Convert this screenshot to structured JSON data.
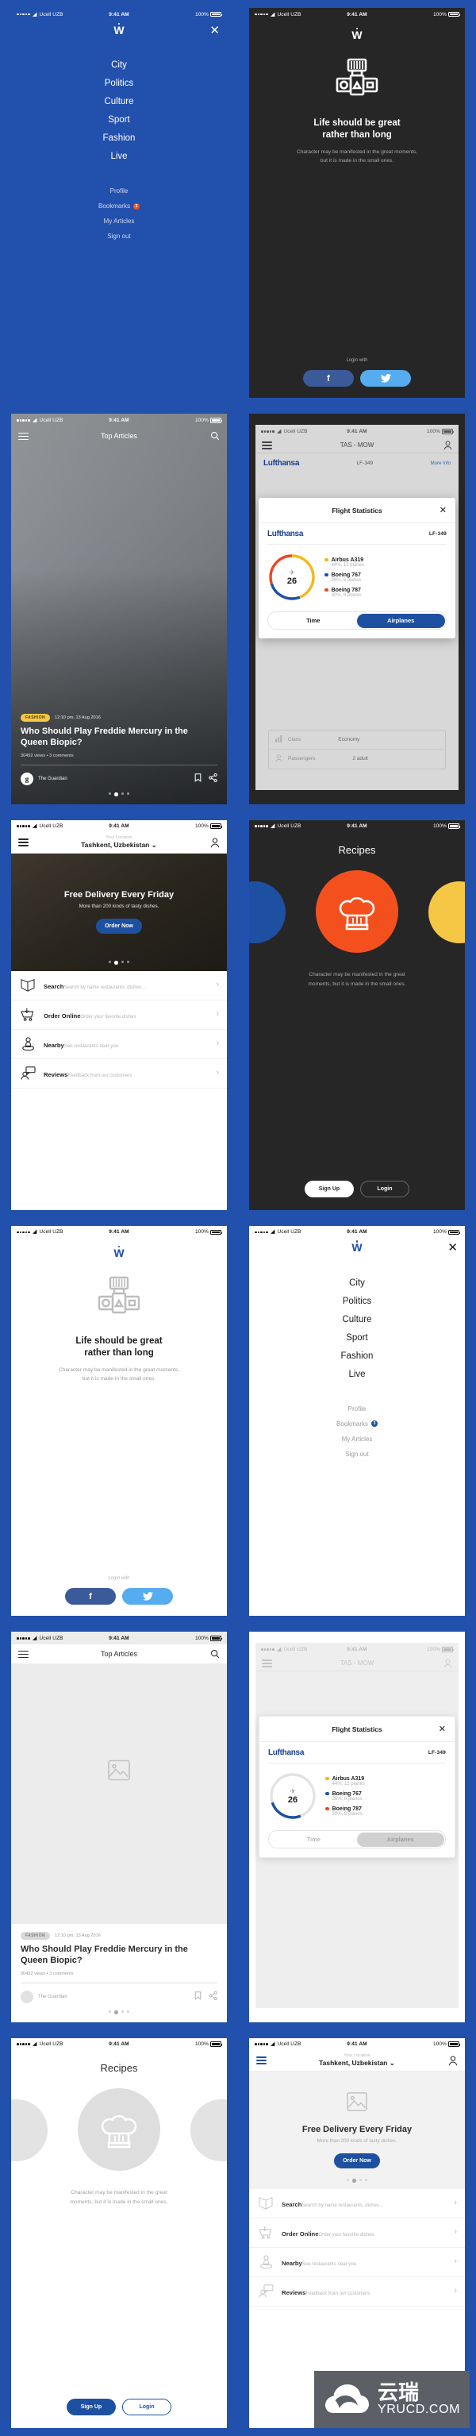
{
  "status_bar": {
    "carrier": "Ucell UZB",
    "time": "9:41 AM",
    "battery": "100%"
  },
  "colors": {
    "brand_blue": "#2250ad",
    "accent_blue": "#1e50a2",
    "dark_bg": "#262626",
    "orange": "#f4511e",
    "yellow": "#f6c744",
    "facebook": "#3b5a9a",
    "twitter": "#55acee",
    "skeleton_grey": "#d8d8d8"
  },
  "menu": {
    "logo": "W",
    "close_label": "✕",
    "primary": [
      "City",
      "Politics",
      "Culture",
      "Sport",
      "Fashion",
      "Live"
    ],
    "secondary": [
      {
        "label": "Profile",
        "badge": ""
      },
      {
        "label": "Bookmarks",
        "badge": "3"
      },
      {
        "label": "My Articles",
        "badge": ""
      },
      {
        "label": "Sign out",
        "badge": ""
      }
    ]
  },
  "onboarding": {
    "logo": "W",
    "headline_line1": "Life should be great",
    "headline_line2": "rather than long",
    "body": "Character may be manifested in the great moments, but it is made in the small ones.",
    "login_with": "Login with",
    "facebook_label": "f",
    "twitter_label": "twitter-bird"
  },
  "article": {
    "nav_title": "Top Articles",
    "tag": "FASHION",
    "timestamp": "12:10 pm, 13 Aug 2016",
    "title": "Who Should Play Freddie Mercury in the Queen Biopic?",
    "meta": "30492 views  •  3 comments",
    "source": "The Guardian",
    "source_initial": "g",
    "pager_total": 4,
    "pager_active": 2
  },
  "flight": {
    "bg_nav_title": "TAS - MOW",
    "bg_airline": "Lufthansa",
    "bg_flight_no": "LF-349",
    "bg_more_info": "More Info",
    "bg_rows": [
      {
        "label": "Class",
        "value": "Economy"
      },
      {
        "label": "Passengers",
        "value": "2 adult"
      }
    ],
    "modal_title": "Flight Statistics",
    "airline": "Lufthansa",
    "flight_no": "LF-349",
    "center_number": "26",
    "tabs": [
      {
        "label": "Time",
        "active": false
      },
      {
        "label": "Airplanes",
        "active": true
      }
    ],
    "chart_data": {
      "type": "pie",
      "title": "Flight Statistics",
      "subtitle": "Lufthansa LF-349",
      "center_label": "26",
      "legend_position": "right",
      "categories": [
        "Airbus A319",
        "Boeing 767",
        "Boeing 787"
      ],
      "values": [
        44,
        26,
        30
      ],
      "counts": [
        12,
        6,
        8
      ],
      "unit": "%",
      "colors": [
        "#f6b718",
        "#1e50a2",
        "#f4431e"
      ],
      "labels": [
        "44%, 12 planes",
        "26%, 6 planes",
        "30%, 8 planes"
      ]
    }
  },
  "recipes": {
    "title": "Recipes",
    "icon": "chef-hat-icon",
    "body": "Character may be manifested in the great moments, but it is made in the small ones.",
    "signup_label": "Sign Up",
    "login_label": "Login",
    "circle_color": "#f4501e",
    "side_left_color": "#1e50a2",
    "side_right_color": "#f6c744"
  },
  "food": {
    "location_label": "Your Location",
    "location_value": "Tashkent, Uzbekistan",
    "hero_title": "Free Delivery Every Friday",
    "hero_sub": "More than 200 kinds of tasty dishes.",
    "order_button": "Order Now",
    "pager_total": 4,
    "pager_active": 2,
    "items": [
      {
        "icon": "book-icon",
        "title": "Search",
        "sub": "Search by name restaurants, dishes…"
      },
      {
        "icon": "cart-icon",
        "title": "Order Online",
        "sub": "Order your favorite dishes"
      },
      {
        "icon": "pin-icon",
        "title": "Nearby",
        "sub": "See restaurants near you"
      },
      {
        "icon": "review-icon",
        "title": "Reviews",
        "sub": "Feedback from our customers"
      }
    ]
  },
  "watermark": {
    "cn": "云瑞",
    "domain": "YRUCD.COM"
  }
}
